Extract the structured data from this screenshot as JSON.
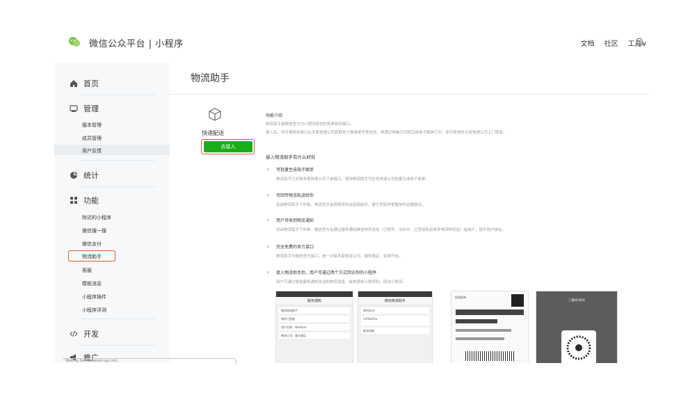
{
  "header": {
    "brand": "微信公众平台 | 小程序",
    "nav": [
      "文档",
      "社区",
      "工具∨"
    ]
  },
  "sidebar": {
    "groups": [
      {
        "title": "首页",
        "icon": "home-icon",
        "items": []
      },
      {
        "title": "管理",
        "icon": "manage-icon",
        "items": [
          "版本管理",
          "成员管理",
          "用户反馈"
        ]
      },
      {
        "title": "统计",
        "icon": "stats-icon",
        "items": []
      },
      {
        "title": "功能",
        "icon": "feature-icon",
        "items": [
          "附近的小程序",
          "微信搜一搜",
          "微信支付",
          "物流助手",
          "客服",
          "模板消息",
          "小程序插件",
          "小程序评测"
        ]
      },
      {
        "title": "开发",
        "icon": "code-icon",
        "items": []
      },
      {
        "title": "推广",
        "icon": "promote-icon",
        "items": []
      }
    ],
    "active_item": "物流助手"
  },
  "main": {
    "title": "物流助手",
    "hero": {
      "name": "快递配送",
      "button": "去接入"
    },
    "intro": {
      "title": "功能介绍",
      "lines": [
        "物流助手是微信官方为小程序提供的免费物流接口。",
        "接入后，你可使用本接口在多家快递公司获取电子面单单号等信息，再通过热敏打印机完成电子面单打印，即可将快件交给快递公司上门揽收。"
      ]
    },
    "benefits_title": "接入物流助手有什么好处",
    "benefits": [
      {
        "title": "可批量生成电子面单",
        "desc": "物流助手已对接多家快递公司下单接口，使用物流助手可在各快递公司批量生成电子面单。"
      },
      {
        "title": "可回传物流轨迹给你",
        "desc": "经由物流助手下的单，物流助手会将物流轨迹返回给你，便于你实时掌握快件运输路径。"
      },
      {
        "title": "用户可收到物流通知",
        "desc": "经由物流助手下的单，微信官方会通过服务通知推送快件状态（已揽件、派件中、已签收和运单异常四种状态）给用户，提升用户体验。"
      },
      {
        "title": "完全免费的官方接口",
        "desc": "物流助手为微信官方接口，统一对接多家物流公司，服务稳定，免费开放。"
      },
      {
        "title": "接入物流助手后，用户可通过两个方式回访你的小程序",
        "desc": "用户可通过微信服务通知发送的物流消息、或快递单小程序码，回访小程序。"
      }
    ],
    "thumbs": {
      "phone1_title": "服务通知",
      "phone1_rows": [
        "微信物流助手",
        "物件已签收",
        "用户名称：WeStore",
        "物流公司：顺丰速运"
      ],
      "phone2_title": "微信物流助手",
      "phone2_rows": [
        "WeStore",
        "Coffe&Tea",
        "配送进度"
      ],
      "receipt_label": "快递面单",
      "qr_title": "二维码/条码"
    }
  },
  "statusbar": {
    "text": "Waiting for mp.weixin.qq.com..."
  },
  "colors": {
    "accent_green": "#1aad19",
    "highlight_orange": "#e35a2d",
    "sidebar_bg": "#f6f8f9"
  }
}
